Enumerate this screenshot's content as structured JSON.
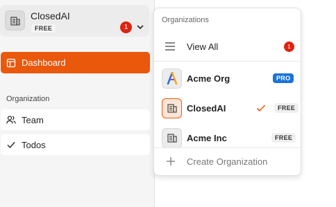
{
  "sidebar": {
    "org_switcher": {
      "name": "ClosedAI",
      "plan": "FREE",
      "notification_count": "1"
    },
    "dashboard_label": "Dashboard",
    "section_label": "Organization",
    "items": [
      {
        "label": "Team",
        "icon": "users-icon"
      },
      {
        "label": "Todos",
        "icon": "check-icon"
      }
    ]
  },
  "dropdown": {
    "header": "Organizations",
    "view_all_label": "View All",
    "view_all_count": "1",
    "orgs": [
      {
        "name": "Acme Org",
        "plan": "PRO",
        "icon": "acme-logo-icon",
        "selected": false
      },
      {
        "name": "ClosedAI",
        "plan": "FREE",
        "icon": "building-icon",
        "selected": true
      },
      {
        "name": "Acme Inc",
        "plan": "FREE",
        "icon": "building-icon",
        "selected": false
      }
    ],
    "create_label": "Create Organization"
  },
  "colors": {
    "accent": "#ea580c",
    "badge_red": "#dc2412",
    "pro_blue": "#1a73d9"
  }
}
